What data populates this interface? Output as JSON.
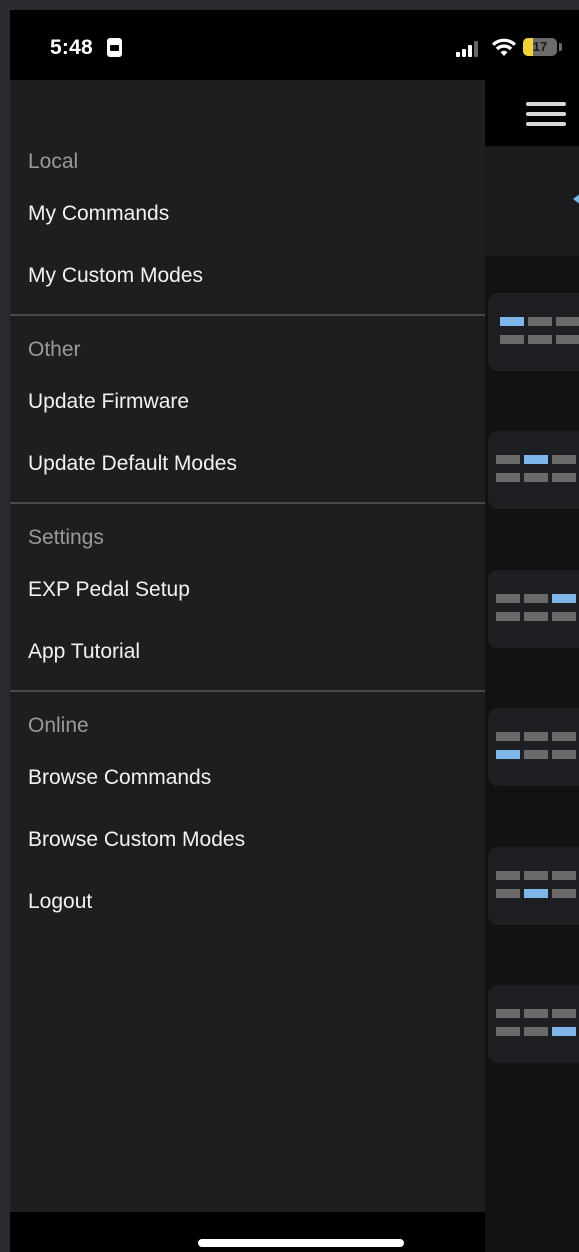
{
  "status_bar": {
    "time": "5:48",
    "battery": "17"
  },
  "drawer": {
    "sections": [
      {
        "header": "Local",
        "items": [
          "My Commands",
          "My Custom Modes"
        ]
      },
      {
        "header": "Other",
        "items": [
          "Update Firmware",
          "Update Default Modes"
        ]
      },
      {
        "header": "Settings",
        "items": [
          "EXP Pedal Setup",
          "App Tutorial"
        ]
      },
      {
        "header": "Online",
        "items": [
          "Browse Commands",
          "Browse Custom Modes",
          "Logout"
        ]
      }
    ]
  },
  "background_app": {
    "mode_cards": [
      {
        "top_row": [
          1,
          0,
          0
        ],
        "bottom_row": [
          0,
          0,
          0
        ]
      },
      {
        "top_row": [
          0,
          1,
          0
        ],
        "bottom_row": [
          0,
          0,
          0
        ]
      },
      {
        "top_row": [
          0,
          0,
          1
        ],
        "bottom_row": [
          0,
          0,
          0
        ]
      },
      {
        "top_row": [
          0,
          0,
          0
        ],
        "bottom_row": [
          1,
          0,
          0
        ]
      },
      {
        "top_row": [
          0,
          0,
          0
        ],
        "bottom_row": [
          0,
          1,
          0
        ]
      },
      {
        "top_row": [
          0,
          0,
          0
        ],
        "bottom_row": [
          0,
          0,
          1
        ]
      }
    ],
    "colors": {
      "led_on": "#7eb6ea",
      "led_off": "#6a6a6a"
    }
  }
}
